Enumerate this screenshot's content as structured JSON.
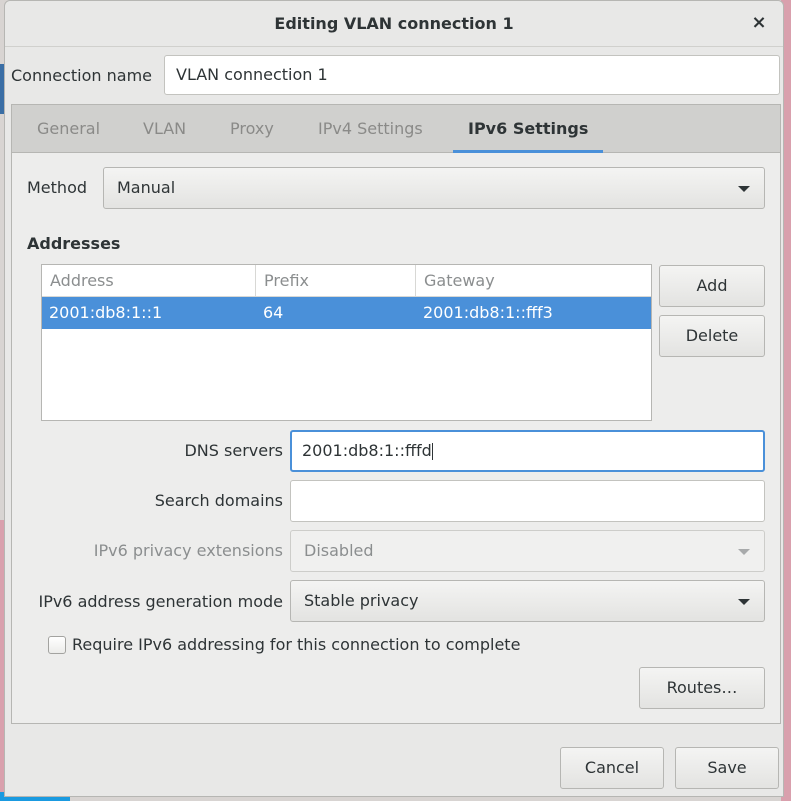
{
  "window": {
    "title": "Editing VLAN connection 1",
    "close_glyph": "×"
  },
  "connection": {
    "label": "Connection name",
    "value": "VLAN connection 1"
  },
  "tabs": [
    {
      "label": "General",
      "active": false
    },
    {
      "label": "VLAN",
      "active": false
    },
    {
      "label": "Proxy",
      "active": false
    },
    {
      "label": "IPv4 Settings",
      "active": false
    },
    {
      "label": "IPv6 Settings",
      "active": true
    }
  ],
  "method": {
    "label": "Method",
    "value": "Manual"
  },
  "addresses": {
    "heading": "Addresses",
    "columns": [
      "Address",
      "Prefix",
      "Gateway"
    ],
    "rows": [
      {
        "address": "2001:db8:1::1",
        "prefix": "64",
        "gateway": "2001:db8:1::fff3",
        "selected": true
      }
    ],
    "add_label": "Add",
    "delete_label": "Delete"
  },
  "dns": {
    "label": "DNS servers",
    "value": "2001:db8:1::fffd"
  },
  "search_domains": {
    "label": "Search domains",
    "value": ""
  },
  "privacy": {
    "label": "IPv6 privacy extensions",
    "value": "Disabled",
    "enabled": false
  },
  "gen_mode": {
    "label": "IPv6 address generation mode",
    "value": "Stable privacy"
  },
  "require": {
    "label": "Require IPv6 addressing for this connection to complete",
    "checked": false
  },
  "routes_label": "Routes…",
  "footer": {
    "cancel_label": "Cancel",
    "save_label": "Save"
  },
  "colors": {
    "accent": "#4a90d9",
    "selection_text": "#ffffff"
  }
}
